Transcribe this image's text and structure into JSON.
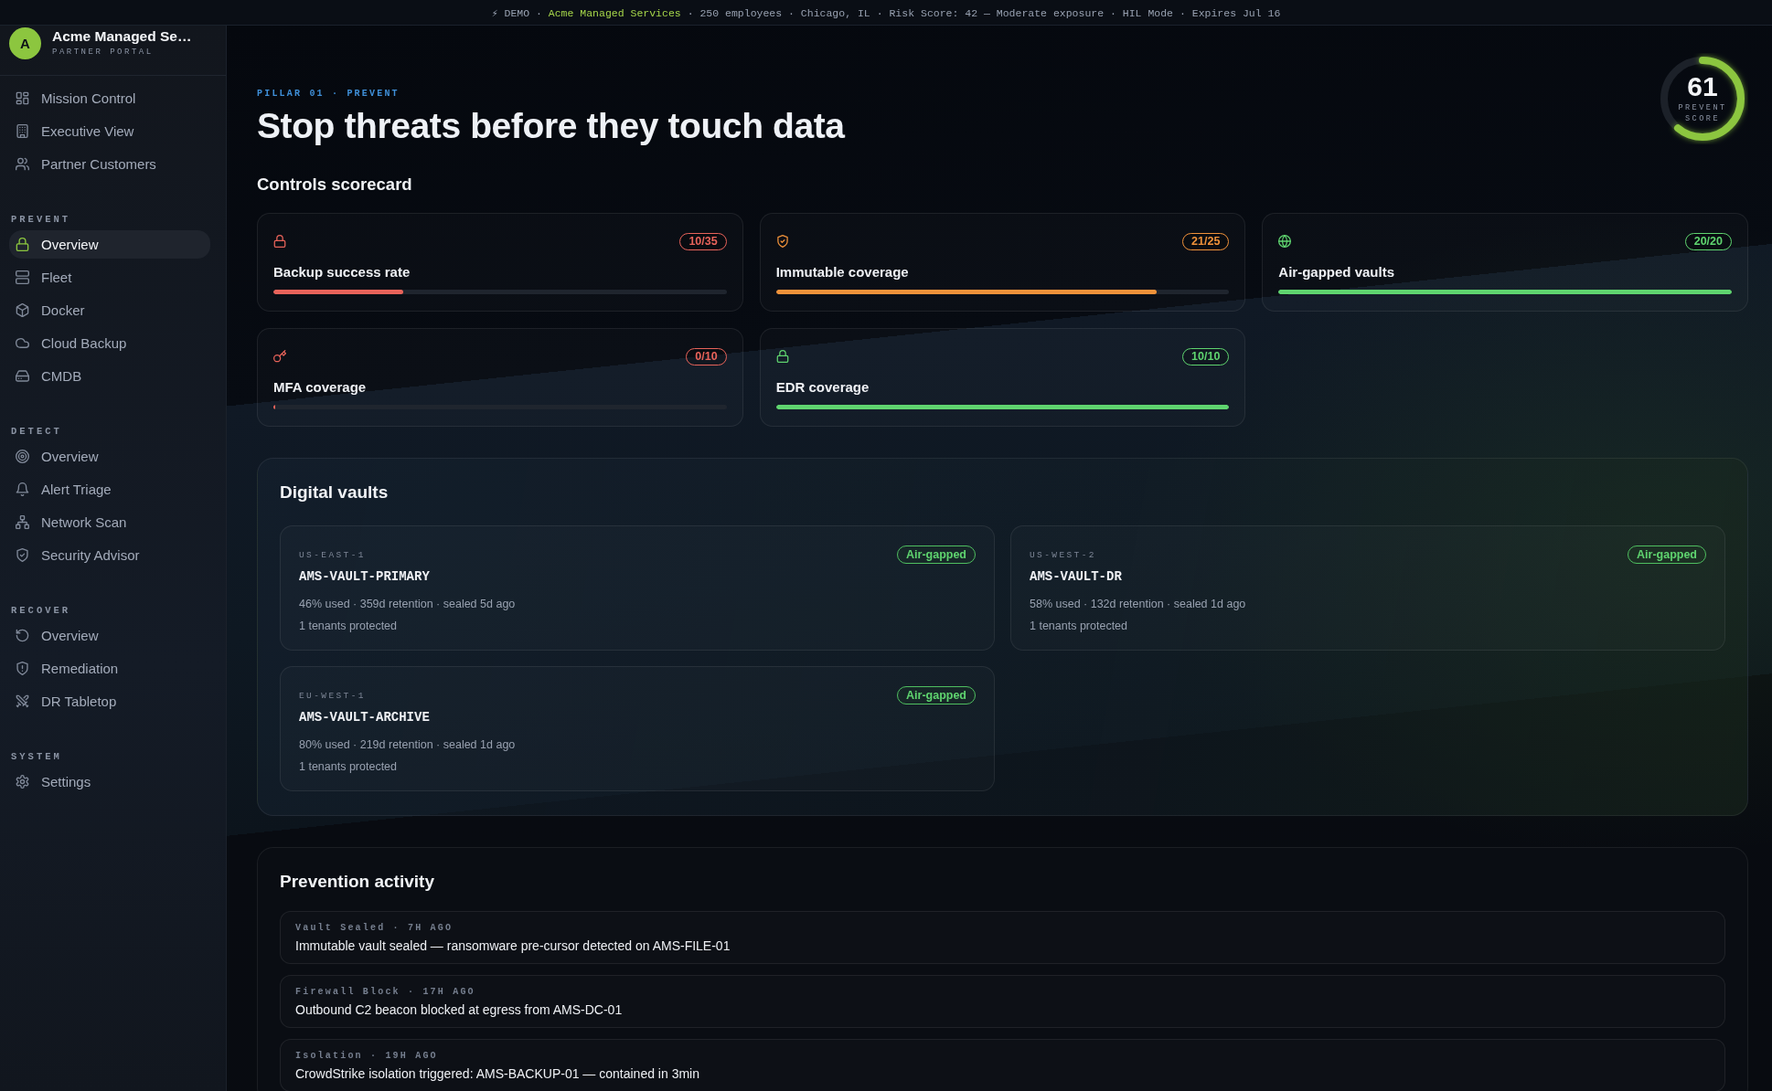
{
  "banner": {
    "prefix": "⚡ DEMO ·",
    "company": "Acme Managed Services",
    "details": "· 250 employees · Chicago, IL · Risk Score: 42 — Moderate exposure · HIL Mode · Expires Jul 16"
  },
  "sidebar": {
    "brand": {
      "avatar": "A",
      "name": "Acme Managed Se…",
      "subtitle": "PARTNER PORTAL"
    },
    "items": [
      {
        "label": "Mission Control",
        "selected": false
      },
      {
        "label": "Executive View",
        "selected": false
      },
      {
        "label": "Partner Customers",
        "selected": false
      }
    ],
    "sections": [
      {
        "title": "PREVENT",
        "items": [
          {
            "label": "Overview",
            "selected": true
          },
          {
            "label": "Fleet",
            "selected": false
          },
          {
            "label": "Docker",
            "selected": false
          },
          {
            "label": "Cloud Backup",
            "selected": false
          },
          {
            "label": "CMDB",
            "selected": false
          }
        ]
      },
      {
        "title": "DETECT",
        "items": [
          {
            "label": "Overview",
            "selected": false
          },
          {
            "label": "Alert Triage",
            "selected": false
          },
          {
            "label": "Network Scan",
            "selected": false
          },
          {
            "label": "Security Advisor",
            "selected": false
          }
        ]
      },
      {
        "title": "RECOVER",
        "items": [
          {
            "label": "Overview",
            "selected": false
          },
          {
            "label": "Remediation",
            "selected": false
          },
          {
            "label": "DR Tabletop",
            "selected": false
          }
        ]
      },
      {
        "title": "SYSTEM",
        "items": [
          {
            "label": "Settings",
            "selected": false
          }
        ]
      }
    ]
  },
  "header": {
    "eyebrow": "PILLAR 01 · PREVENT",
    "title": "Stop threats before they touch data"
  },
  "score": {
    "value": "61",
    "label": "PREVENT SCORE",
    "level": 0.61
  },
  "scorecard": {
    "title": "Controls scorecard",
    "controls": [
      {
        "name": "Backup success rate",
        "count": "10/35",
        "level": 0.286,
        "color": "#e8635a"
      },
      {
        "name": "Immutable coverage",
        "count": "21/25",
        "level": 0.84,
        "color": "#f0923a"
      },
      {
        "name": "Air-gapped vaults",
        "count": "20/20",
        "level": 1,
        "color": "#5fd46f"
      },
      {
        "name": "MFA coverage",
        "count": "0/10",
        "level": 0,
        "color": "#e8635a"
      },
      {
        "name": "EDR coverage",
        "count": "10/10",
        "level": 1,
        "color": "#5fd46f"
      }
    ]
  },
  "vaults": {
    "title": "Digital vaults",
    "items": [
      {
        "region": "US-EAST-1",
        "name": "AMS-VAULT-PRIMARY",
        "badge": "Air-gapped",
        "details": "46% used · 359d retention · sealed 5d ago",
        "tenants": "1 tenants protected"
      },
      {
        "region": "US-WEST-2",
        "name": "AMS-VAULT-DR",
        "badge": "Air-gapped",
        "details": "58% used · 132d retention · sealed 1d ago",
        "tenants": "1 tenants protected"
      },
      {
        "region": "EU-WEST-1",
        "name": "AMS-VAULT-ARCHIVE",
        "badge": "Air-gapped",
        "details": "80% used · 219d retention · sealed 1d ago",
        "tenants": "1 tenants protected"
      }
    ]
  },
  "activity": {
    "title": "Prevention activity",
    "events": [
      {
        "meta": "Vault Sealed · 7H AGO",
        "text": "Immutable vault sealed — ransomware pre-cursor detected on AMS-FILE-01"
      },
      {
        "meta": "Firewall Block · 17H AGO",
        "text": "Outbound C2 beacon blocked at egress from AMS-DC-01"
      },
      {
        "meta": "Isolation · 19H AGO",
        "text": "CrowdStrike isolation triggered: AMS-BACKUP-01 — contained in 3min"
      }
    ]
  }
}
